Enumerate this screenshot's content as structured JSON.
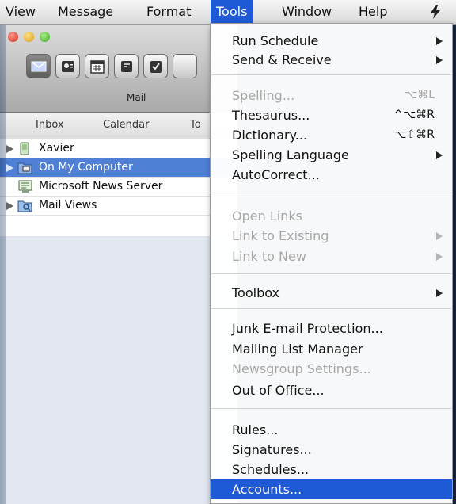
{
  "menubar": {
    "items": [
      "View",
      "Message",
      "Format",
      "Tools",
      "Window",
      "Help"
    ],
    "active": "Tools"
  },
  "toolbar": {
    "selected_label": "Mail",
    "buttons": [
      "mail-icon",
      "contacts-icon",
      "calendar-icon",
      "notes-icon",
      "tasks-icon"
    ]
  },
  "tabs": [
    "Inbox",
    "Calendar",
    "To"
  ],
  "sidebar": {
    "items": [
      {
        "label": "Xavier",
        "icon": "phone-icon",
        "expandable": true,
        "selected": false
      },
      {
        "label": "On My Computer",
        "icon": "computer-folder-icon",
        "expandable": true,
        "selected": true
      },
      {
        "label": "Microsoft News Server",
        "icon": "news-server-icon",
        "expandable": false,
        "selected": false
      },
      {
        "label": "Mail Views",
        "icon": "mail-views-icon",
        "expandable": true,
        "selected": false
      }
    ]
  },
  "tools_menu": {
    "run_schedule": "Run Schedule",
    "send_receive": "Send & Receive",
    "spelling": "Spelling...",
    "spelling_sc": "⌥⌘L",
    "thesaurus": "Thesaurus...",
    "thesaurus_sc": "^⌥⌘R",
    "dictionary": "Dictionary...",
    "dictionary_sc": "⌥⇧⌘R",
    "spelling_language": "Spelling Language",
    "autocorrect": "AutoCorrect...",
    "open_links": "Open Links",
    "link_existing": "Link to Existing",
    "link_new": "Link to New",
    "toolbox": "Toolbox",
    "junk": "Junk E-mail Protection...",
    "mailing_list": "Mailing List Manager",
    "newsgroup": "Newsgroup Settings...",
    "out_of_office": "Out of Office...",
    "rules": "Rules...",
    "signatures": "Signatures...",
    "schedules": "Schedules...",
    "accounts": "Accounts..."
  },
  "colors": {
    "menu_highlight": "#1f5ad6",
    "selected_row": "#4f80d6"
  }
}
